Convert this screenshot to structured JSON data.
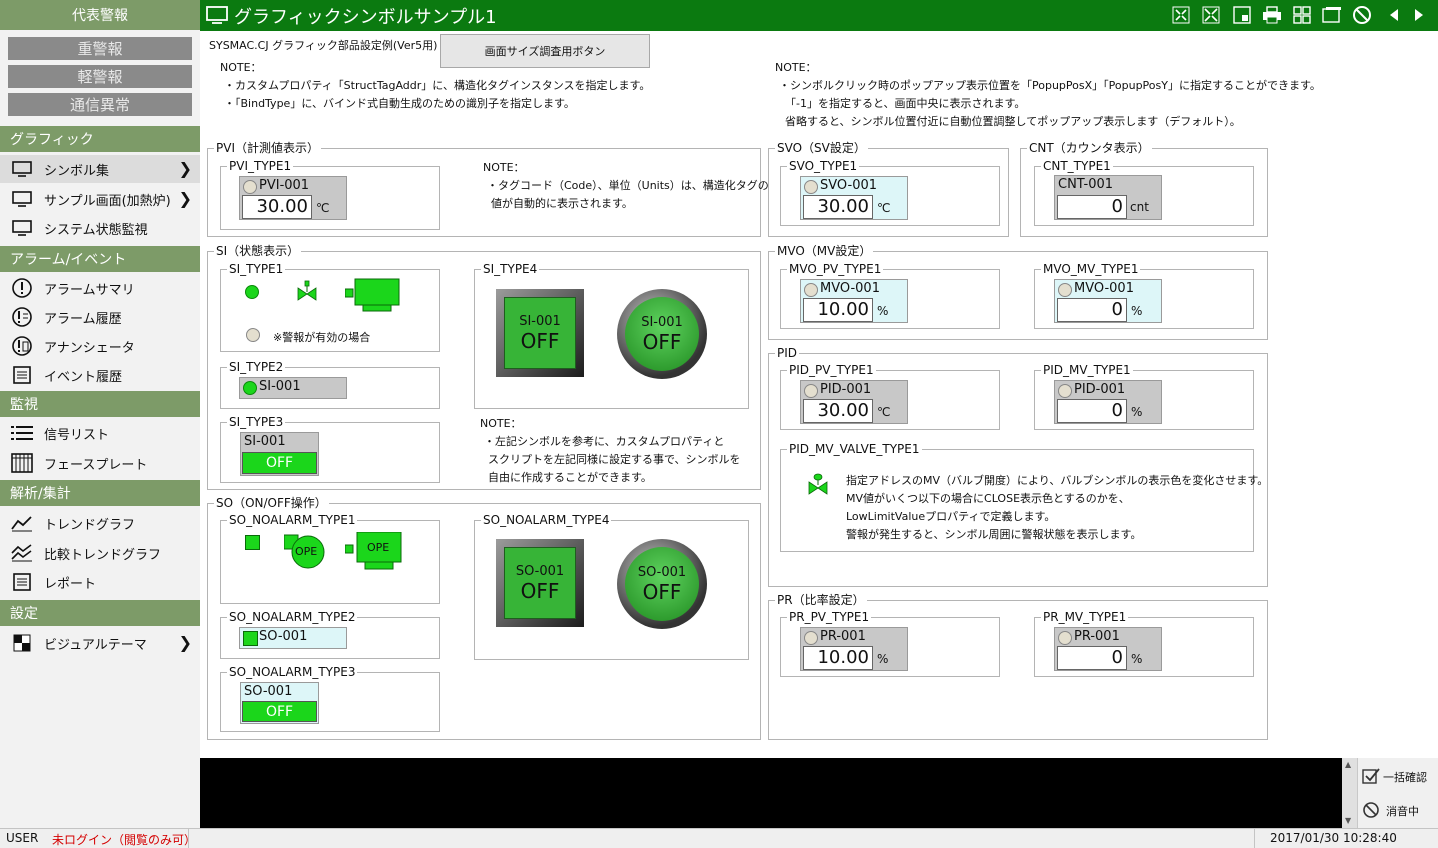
{
  "app": {
    "title": "グラフィックシンボルサンプル1"
  },
  "sidebar": {
    "title": "代表警報",
    "alarms": [
      "重警報",
      "軽警報",
      "通信異常"
    ],
    "sections": {
      "graphics": {
        "header": "グラフィック",
        "items": [
          "シンボル集",
          "サンプル画面(加熱炉)",
          "システム状態監視"
        ]
      },
      "alarm": {
        "header": "アラーム/イベント",
        "items": [
          "アラームサマリ",
          "アラーム履歴",
          "アナンシェータ",
          "イベント履歴"
        ]
      },
      "monitor": {
        "header": "監視",
        "items": [
          "信号リスト",
          "フェースプレート"
        ]
      },
      "analysis": {
        "header": "解析/集計",
        "items": [
          "トレンドグラフ",
          "比較トレンドグラフ",
          "レポート"
        ]
      },
      "settings": {
        "header": "設定",
        "items": [
          "ビジュアルテーマ"
        ]
      }
    }
  },
  "toolbar": {
    "icons": [
      "fit-screen-icon",
      "expand-icon",
      "window-icon",
      "print-icon",
      "layout-icon",
      "window-min-icon",
      "no-entry-icon",
      "prev-arrow-icon",
      "next-arrow-icon"
    ]
  },
  "header": {
    "caption": "SYSMAC.CJ グラフィック部品設定例(Ver5用)",
    "button": "画面サイズ調査用ボタン",
    "note_left": {
      "title": "NOTE：",
      "lines": [
        "・カスタムプロパティ「StructTagAddr」に、構造化タグインスタンスを指定します。",
        "・「BindType」に、バインド式自動生成のための識別子を指定します。"
      ]
    },
    "note_right": {
      "title": "NOTE：",
      "lines": [
        "・シンボルクリック時のポップアップ表示位置を「PopupPosX」「PopupPosY」に指定することができます。",
        "「-1」を指定すると、画面中央に表示されます。",
        "省略すると、シンボル位置付近に自動位置調整してポップアップ表示します（デフォルト）。"
      ]
    }
  },
  "pvi": {
    "legend": "PVI（計測値表示）",
    "type1": {
      "legend": "PVI_TYPE1",
      "tag": "PVI-001",
      "value": "30.00",
      "unit": "℃"
    },
    "note": {
      "title": "NOTE：",
      "lines": [
        "・タグコード（Code）、単位（Units）は、構造化タグの",
        "値が自動的に表示されます。"
      ]
    }
  },
  "si": {
    "legend": "SI（状態表示）",
    "type1": {
      "legend": "SI_TYPE1",
      "caption": "※警報が有効の場合"
    },
    "type2": {
      "legend": "SI_TYPE2",
      "tag": "SI-001"
    },
    "type3": {
      "legend": "SI_TYPE3",
      "tag": "SI-001",
      "state": "OFF"
    },
    "type4": {
      "legend": "SI_TYPE4",
      "btn1_tag": "SI-001",
      "btn1_state": "OFF",
      "btn2_tag": "SI-001",
      "btn2_state": "OFF"
    },
    "note": {
      "title": "NOTE：",
      "lines": [
        "・左記シンボルを参考に、カスタムプロパティと",
        "スクリプトを左記同様に設定する事で、シンボルを",
        "自由に作成することができます。"
      ]
    }
  },
  "so": {
    "legend": "SO（ON/OFF操作）",
    "type1": {
      "legend": "SO_NOALARM_TYPE1",
      "label1": "OPE",
      "label2": "OPE"
    },
    "type2": {
      "legend": "SO_NOALARM_TYPE2",
      "tag": "SO-001"
    },
    "type3": {
      "legend": "SO_NOALARM_TYPE3",
      "tag": "SO-001",
      "state": "OFF"
    },
    "type4": {
      "legend": "SO_NOALARM_TYPE4",
      "btn1_tag": "SO-001",
      "btn1_state": "OFF",
      "btn2_tag": "SO-001",
      "btn2_state": "OFF"
    }
  },
  "svo": {
    "legend": "SVO（SV設定）",
    "type1": {
      "legend": "SVO_TYPE1",
      "tag": "SVO-001",
      "value": "30.00",
      "unit": "℃"
    }
  },
  "cnt": {
    "legend": "CNT（カウンタ表示）",
    "type1": {
      "legend": "CNT_TYPE1",
      "tag": "CNT-001",
      "value": "0",
      "unit": "cnt"
    }
  },
  "mvo": {
    "legend": "MVO（MV設定）",
    "pv": {
      "legend": "MVO_PV_TYPE1",
      "tag": "MVO-001",
      "value": "10.00",
      "unit": "%"
    },
    "mv": {
      "legend": "MVO_MV_TYPE1",
      "tag": "MVO-001",
      "value": "0",
      "unit": "%"
    }
  },
  "pid": {
    "legend": "PID",
    "pv": {
      "legend": "PID_PV_TYPE1",
      "tag": "PID-001",
      "value": "30.00",
      "unit": "℃"
    },
    "mv": {
      "legend": "PID_MV_TYPE1",
      "tag": "PID-001",
      "value": "0",
      "unit": "%"
    },
    "valve": {
      "legend": "PID_MV_VALVE_TYPE1",
      "lines": [
        "指定アドレスのMV（バルブ開度）により、バルブシンボルの表示色を変化させます。",
        "MV値がいくつ以下の場合にCLOSE表示色とするのかを、",
        "LowLimitValueプロパティで定義します。",
        "警報が発生すると、シンボル周囲に警報状態を表示します。"
      ]
    }
  },
  "pr": {
    "legend": "PR（比率設定）",
    "pv": {
      "legend": "PR_PV_TYPE1",
      "tag": "PR-001",
      "value": "10.00",
      "unit": "%"
    },
    "mv": {
      "legend": "PR_MV_TYPE1",
      "tag": "PR-001",
      "value": "0",
      "unit": "%"
    }
  },
  "messages": {
    "ack_all": "一括確認",
    "mute": "消音中"
  },
  "status": {
    "user_label": "USER",
    "user_value": "未ログイン（閲覧のみ可）",
    "datetime": "2017/01/30 10:28:40"
  },
  "colors": {
    "accent": "#0b7a10",
    "sidebar_header": "#7d9b68",
    "led_green": "#1bd61b",
    "error_text": "#d40000"
  }
}
